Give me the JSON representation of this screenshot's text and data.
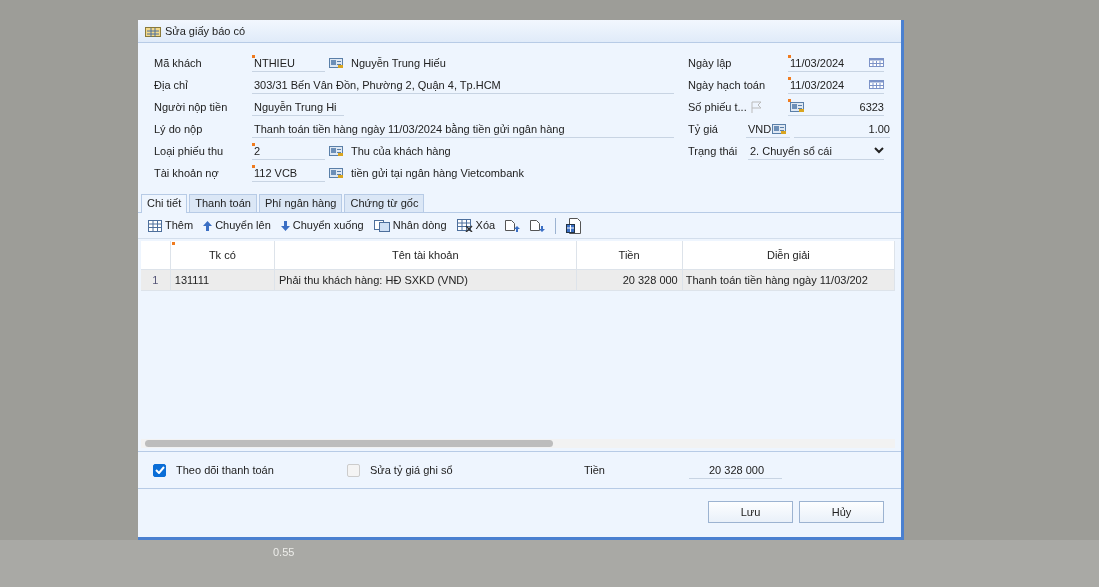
{
  "backdrop_text": "0.55",
  "window": {
    "title": "Sửa giấy báo có"
  },
  "left_fields": [
    {
      "kind": "lookup",
      "label": "Mã khách",
      "value": "NTHIEU",
      "required": true,
      "description": "Nguyễn Trung Hiếu"
    },
    {
      "kind": "wide",
      "label": "Địa chỉ",
      "value": "303/31 Bến Vân Đồn, Phường 2, Quận 4, Tp.HCM",
      "required": false
    },
    {
      "kind": "short",
      "label": "Người nộp tiền",
      "value": "Nguyễn Trung Hi",
      "required": false
    },
    {
      "kind": "wide",
      "label": "Lý do nộp",
      "value": "Thanh toán tiền hàng ngày 11/03/2024 bằng tiền gửi ngân hàng",
      "required": false
    },
    {
      "kind": "lookup",
      "label": "Loại phiếu thu",
      "value": "2",
      "required": true,
      "description": "Thu của khách hàng"
    },
    {
      "kind": "lookup",
      "label": "Tài khoản nợ",
      "value": "112 VCB",
      "required": true,
      "description": "tiền gửi tại ngân hàng Vietcombank"
    }
  ],
  "right_fields": [
    {
      "kind": "date",
      "label": "Ngày lập",
      "value": "11/03/2024",
      "required": true
    },
    {
      "kind": "date",
      "label": "Ngày hạch toán",
      "value": "11/03/2024",
      "required": true
    },
    {
      "kind": "number",
      "label": "Số phiếu t...",
      "value": "6323",
      "required": true
    },
    {
      "kind": "rate",
      "label": "Tỷ giá",
      "currency": "VND",
      "value": "1.00",
      "required": false
    },
    {
      "kind": "select",
      "label": "Trạng thái",
      "value": "2. Chuyển sổ cái",
      "required": false
    }
  ],
  "tabs": [
    {
      "label": "Chi tiết",
      "selected": true
    },
    {
      "label": "Thanh toán",
      "selected": false
    },
    {
      "label": "Phí ngân hàng",
      "selected": false
    },
    {
      "label": "Chứng từ gốc",
      "selected": false
    }
  ],
  "toolbar": [
    "Thêm",
    "Chuyển lên",
    "Chuyển xuống",
    "Nhân dòng",
    "Xóa"
  ],
  "table": {
    "columns": [
      {
        "label": "Tk có",
        "required": true
      },
      {
        "label": "Tên tài khoản",
        "required": false
      },
      {
        "label": "Tiền",
        "required": false
      },
      {
        "label": "Diễn giải",
        "required": false
      }
    ],
    "rows": [
      {
        "number": "1",
        "cells": [
          "131111",
          "Phải thu khách hàng: HĐ SXKD (VND)",
          "20 328 000",
          "Thanh toán tiền hàng ngày 11/03/202"
        ]
      }
    ]
  },
  "footer": {
    "options": [
      {
        "label": "Theo dõi thanh toán",
        "checked": true
      },
      {
        "label": "Sửa tỷ giá ghi sổ",
        "checked": false
      }
    ],
    "total_label": "Tiền",
    "total": "20 328 000"
  },
  "buttons": [
    "Lưu",
    "Hủy"
  ]
}
